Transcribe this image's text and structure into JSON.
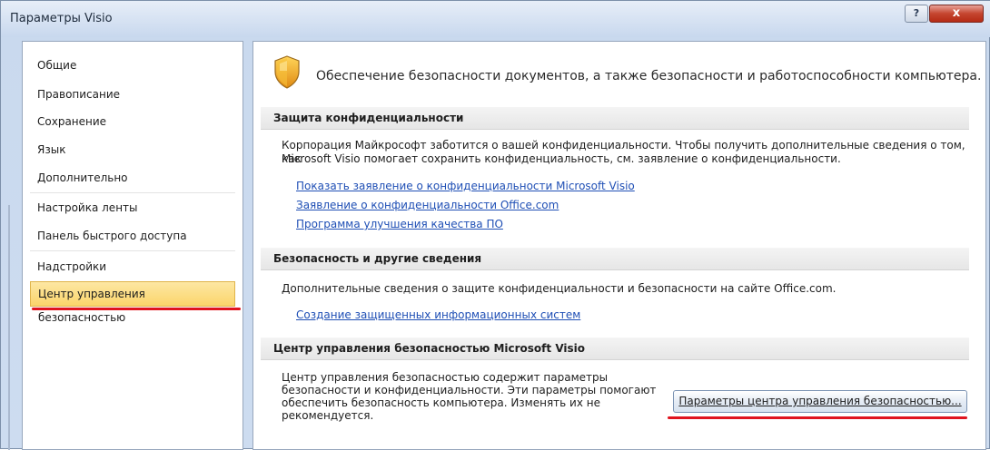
{
  "window": {
    "title": "Параметры Visio",
    "help_glyph": "?",
    "close_glyph": "x"
  },
  "nav": {
    "items": [
      {
        "label": "Общие"
      },
      {
        "label": "Правописание"
      },
      {
        "label": "Сохранение"
      },
      {
        "label": "Язык"
      },
      {
        "label": "Дополнительно"
      },
      {
        "label": "Настройка ленты"
      },
      {
        "label": "Панель быстрого доступа"
      },
      {
        "label": "Надстройки"
      },
      {
        "label": "Центр управления безопасностью",
        "selected": true
      }
    ]
  },
  "content": {
    "header": "Обеспечение безопасности документов, а также безопасности и работоспособности компьютера.",
    "privacy": {
      "title": "Защита конфиденциальности",
      "text_line1": "Корпорация Майкрософт заботится о вашей конфиденциальности. Чтобы получить дополнительные сведения о том, как",
      "text_line2": "Microsoft Visio помогает сохранить конфиденциальность, см. заявление о конфиденциальности.",
      "links": [
        "Показать заявление о конфиденциальности Microsoft Visio",
        "Заявление о конфиденциальности Office.com",
        "Программа улучшения качества ПО"
      ]
    },
    "security": {
      "title": "Безопасность и другие сведения",
      "text": "Дополнительные сведения о защите конфиденциальности и безопасности на сайте Office.com.",
      "link": "Создание защищенных информационных систем"
    },
    "trust_center": {
      "title": "Центр управления безопасностью Microsoft Visio",
      "text_line1": "Центр управления безопасностью содержит параметры",
      "text_line2": "безопасности и конфиденциальности. Эти параметры помогают",
      "text_line3": "обеспечить безопасность компьютера. Изменять их не",
      "text_line4": "рекомендуется.",
      "button_label": "Параметры центра управления безопасностью..."
    }
  },
  "colors": {
    "highlight_annotation": "#e0141e",
    "selected_item": "#fbd56b",
    "link": "#1f4fb5"
  }
}
